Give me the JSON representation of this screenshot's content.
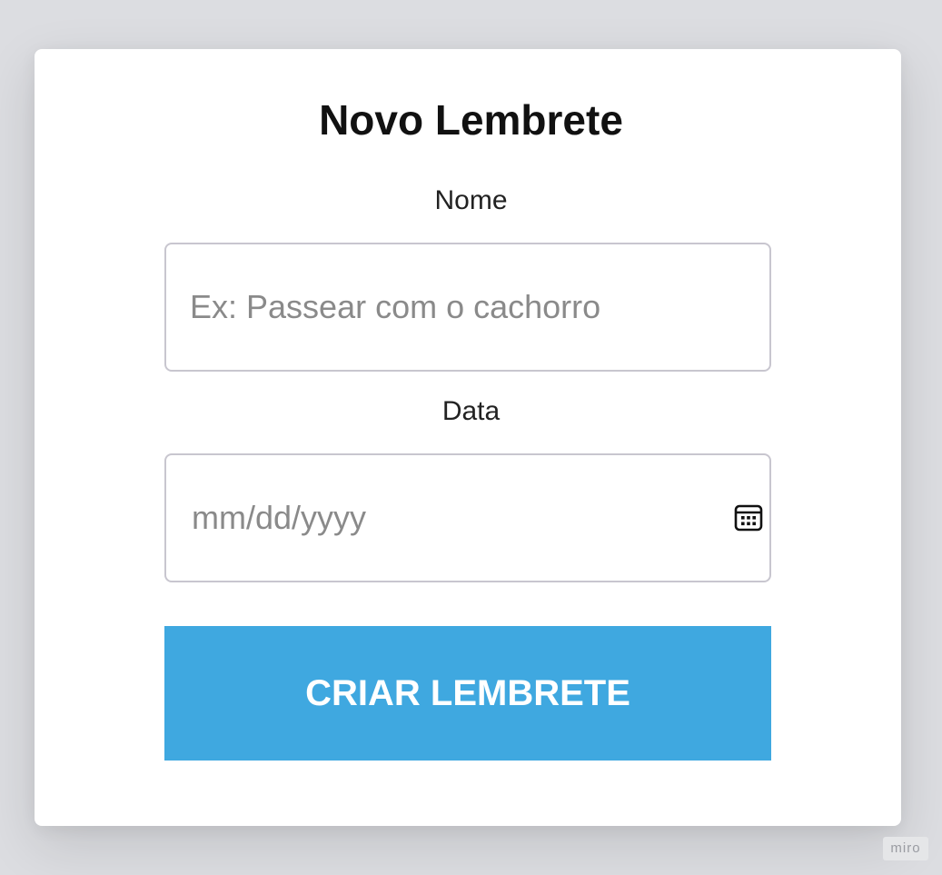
{
  "form": {
    "title": "Novo Lembrete",
    "name_label": "Nome",
    "name_placeholder": "Ex: Passear com o cachorro",
    "date_label": "Data",
    "date_placeholder": "mm/dd/yyyy",
    "submit_label": "CRIAR LEMBRETE"
  },
  "icons": {
    "date_picker": "calendar-icon"
  },
  "colors": {
    "background": "#dcdde1",
    "card": "#ffffff",
    "button": "#3fa8e0",
    "button_text": "#ffffff",
    "input_border": "#c8c6cf",
    "placeholder": "#8a8a8a"
  },
  "watermark": {
    "text": "miro"
  }
}
